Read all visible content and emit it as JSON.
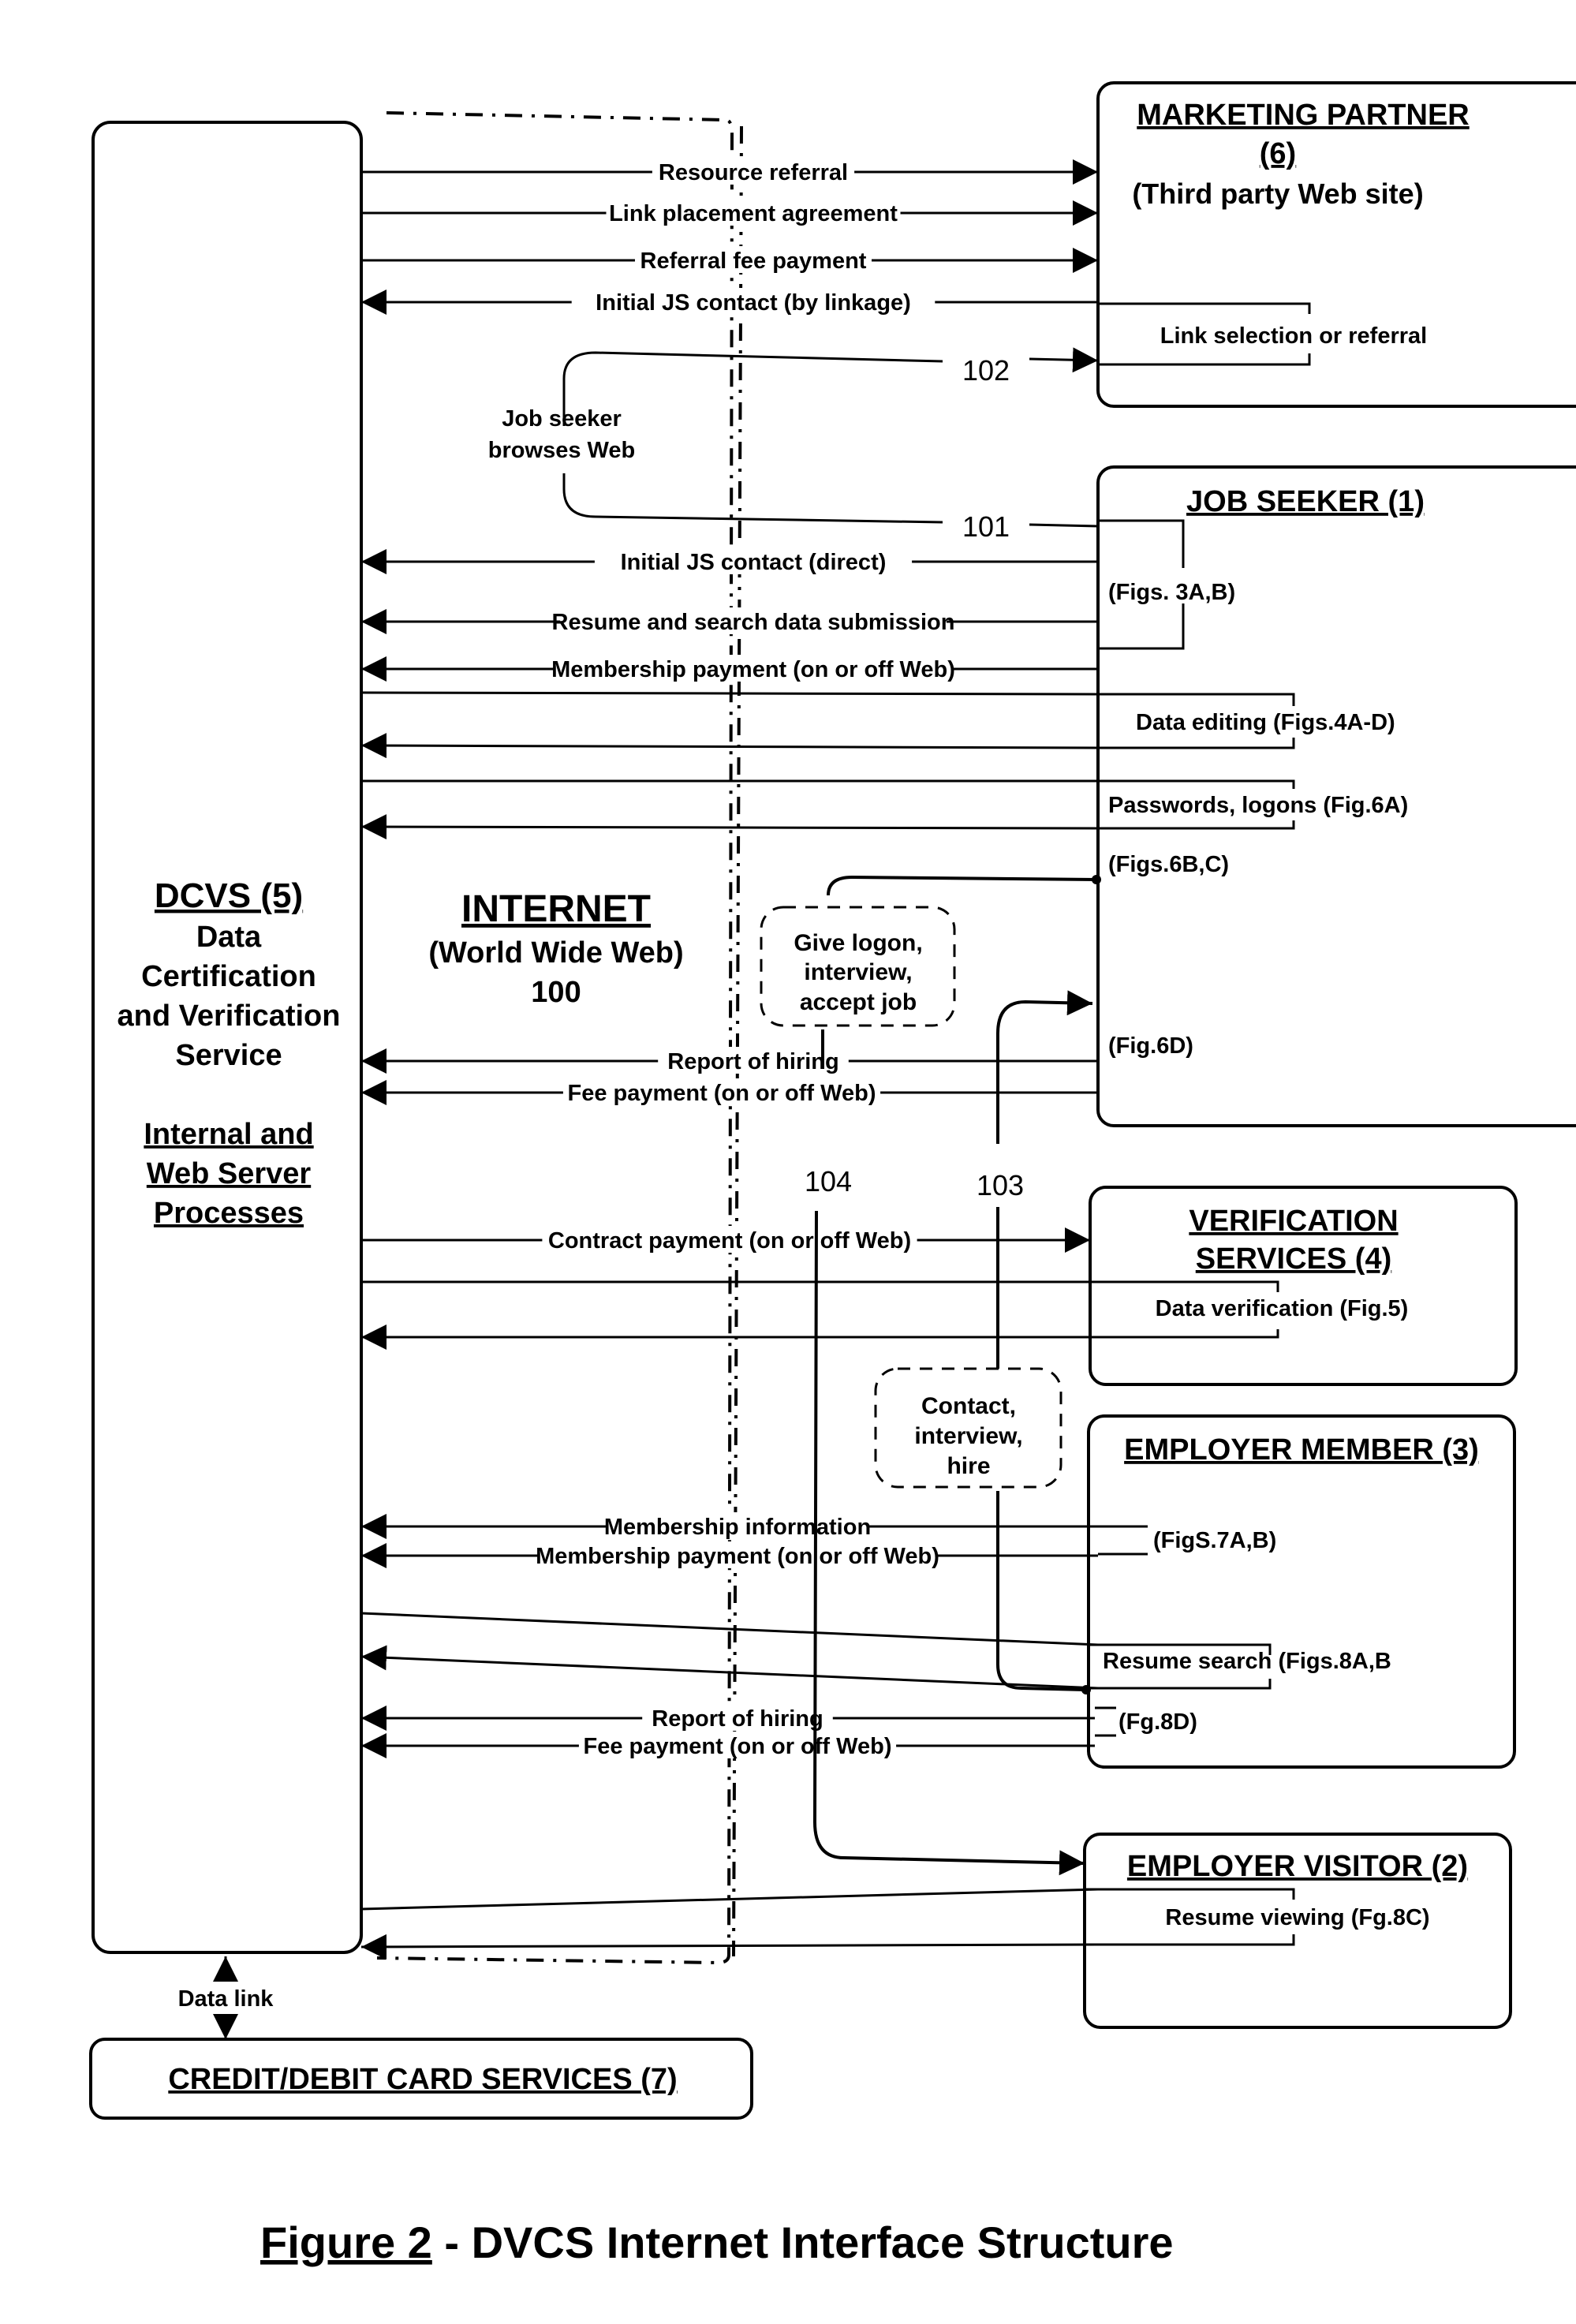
{
  "figure": {
    "caption_prefix": "Figure 2",
    "caption_rest": " - DVCS Internet Interface Structure"
  },
  "internet": {
    "title": "INTERNET",
    "subtitle": "(World Wide Web)",
    "ref": "100"
  },
  "dcvs": {
    "title": "DCVS (5)",
    "lines": [
      "Data",
      "Certification",
      "and Verification",
      "Service"
    ],
    "sub_lines": [
      "Internal and",
      "Web Server",
      "Processes"
    ]
  },
  "entities": {
    "marketing_partner": {
      "title": "MARKETING PARTNER",
      "number": "(6)",
      "subtitle": "(Third party Web site)",
      "inner_label": "Link selection or referral"
    },
    "job_seeker": {
      "title": "JOB SEEKER (1)",
      "labels": [
        "(Figs. 3A,B)",
        "Data editing (Figs.4A-D)",
        "Passwords,  logons (Fig.6A)",
        "(Figs.6B,C)",
        "(Fig.6D)"
      ]
    },
    "verification_services": {
      "title_line1": "VERIFICATION",
      "title_line2": "SERVICES (4)",
      "inner_label": "Data verification (Fig.5)"
    },
    "employer_member": {
      "title": "EMPLOYER MEMBER (3)",
      "labels": [
        "(FigS.7A,B)",
        "Resume search (Figs.8A,B",
        "(Fg.8D)"
      ]
    },
    "employer_visitor": {
      "title": "EMPLOYER VISITOR (2)",
      "inner_label": "Resume viewing (Fg.8C)"
    },
    "card_services": {
      "title": "CREDIT/DEBIT CARD SERVICES (7)"
    }
  },
  "flows": [
    {
      "label": "Resource referral",
      "direction": "to-marketing-partner"
    },
    {
      "label": "Link  placement agreement",
      "direction": "to-marketing-partner"
    },
    {
      "label": "Referral fee payment",
      "direction": "to-marketing-partner"
    },
    {
      "label": "Initial JS contact (by linkage)",
      "direction": "to-dcvs"
    },
    {
      "label": "Initial JS contact (direct)",
      "direction": "to-dcvs"
    },
    {
      "label": "Resume and search data submission",
      "direction": "to-dcvs"
    },
    {
      "label": "Membership payment (on or off Web)",
      "direction": "to-dcvs"
    },
    {
      "label": "Report of hiring",
      "direction": "to-dcvs"
    },
    {
      "label": "Fee payment (on or off Web)",
      "direction": "to-dcvs"
    },
    {
      "label": "Contract payment (on or off Web)",
      "direction": "to-verification-services"
    },
    {
      "label": "Membership information",
      "direction": "to-dcvs"
    },
    {
      "label": "Membership payment (on or off Web)",
      "direction": "to-dcvs"
    },
    {
      "label": "Report of hiring",
      "direction": "to-dcvs"
    },
    {
      "label": "Fee payment (on or off Web)",
      "direction": "to-dcvs"
    }
  ],
  "paths": {
    "browse_label": [
      "Job seeker",
      "browses Web"
    ],
    "ref_101": "101",
    "ref_102": "102",
    "ref_103": "103",
    "ref_104": "104",
    "note_give_logon": [
      "Give logon,",
      "interview,",
      "accept job"
    ],
    "note_contact": [
      "Contact,",
      "interview,",
      "hire"
    ]
  },
  "data_link": {
    "label": "Data link"
  }
}
